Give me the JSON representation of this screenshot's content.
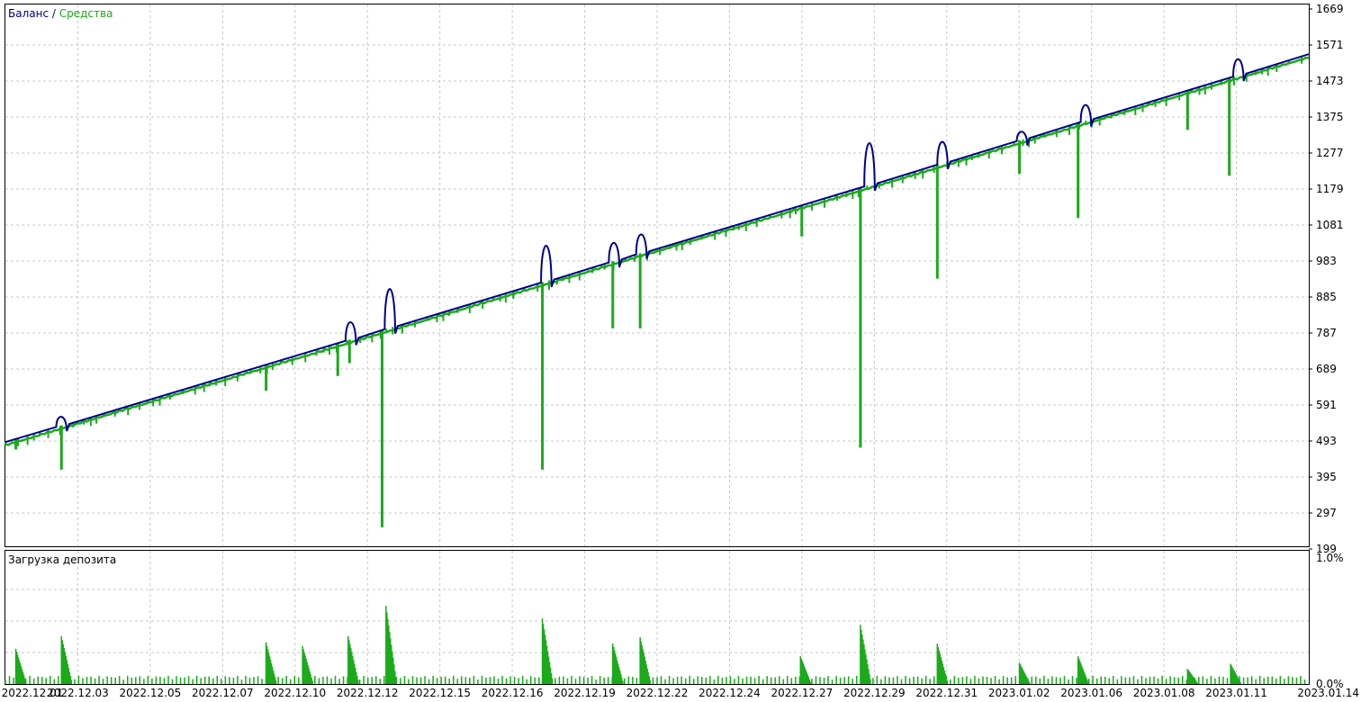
{
  "legend": {
    "balance_label": "Баланс",
    "separator": " / ",
    "equity_label": "Средства",
    "balance_color": "#00008b",
    "equity_color": "#1aaa1a"
  },
  "deposit_label": "Загрузка депозита",
  "chart_data": [
    {
      "type": "line",
      "title": "",
      "series": [
        {
          "name": "Баланс",
          "color": "#00008b"
        },
        {
          "name": "Средства",
          "color": "#1aaa1a"
        }
      ],
      "x_ticks": [
        "2022.12.01",
        "2022.12.03",
        "2022.12.05",
        "2022.12.07",
        "2022.12.10",
        "2022.12.12",
        "2022.12.15",
        "2022.12.16",
        "2022.12.19",
        "2022.12.22",
        "2022.12.24",
        "2022.12.27",
        "2022.12.29",
        "2022.12.31",
        "2023.01.02",
        "2023.01.06",
        "2023.01.08",
        "2023.01.11",
        "2023.01.14"
      ],
      "y_ticks": [
        "1669",
        "1571",
        "1473",
        "1375",
        "1277",
        "1179",
        "1081",
        "983",
        "885",
        "787",
        "689",
        "591",
        "493",
        "395",
        "297",
        "199"
      ],
      "ylim": [
        199,
        1669
      ],
      "trend": [
        {
          "x": 0,
          "y": 490
        },
        {
          "x": 1,
          "y": 1546
        }
      ],
      "balance_bumps": [
        {
          "x": 0.043,
          "peak": 560
        },
        {
          "x": 0.265,
          "peak": 825
        },
        {
          "x": 0.295,
          "peak": 935
        },
        {
          "x": 0.415,
          "peak": 1050
        },
        {
          "x": 0.467,
          "peak": 1042
        },
        {
          "x": 0.488,
          "peak": 1065
        },
        {
          "x": 0.663,
          "peak": 1335
        },
        {
          "x": 0.719,
          "peak": 1320
        },
        {
          "x": 0.78,
          "peak": 1335
        },
        {
          "x": 0.829,
          "peak": 1415
        },
        {
          "x": 0.946,
          "peak": 1540
        }
      ],
      "equity_dips": [
        {
          "x": 0.008,
          "low": 470
        },
        {
          "x": 0.043,
          "low": 415
        },
        {
          "x": 0.2,
          "low": 630
        },
        {
          "x": 0.255,
          "low": 670
        },
        {
          "x": 0.264,
          "low": 705
        },
        {
          "x": 0.289,
          "low": 258
        },
        {
          "x": 0.412,
          "low": 415
        },
        {
          "x": 0.466,
          "low": 800
        },
        {
          "x": 0.487,
          "low": 800
        },
        {
          "x": 0.611,
          "low": 1050
        },
        {
          "x": 0.656,
          "low": 475
        },
        {
          "x": 0.715,
          "low": 935
        },
        {
          "x": 0.778,
          "low": 1220
        },
        {
          "x": 0.823,
          "low": 1100
        },
        {
          "x": 0.907,
          "low": 1340
        },
        {
          "x": 0.939,
          "low": 1215
        }
      ]
    },
    {
      "type": "bar",
      "title": "Загрузка депозита",
      "y_ticks": [
        "1.0%",
        "0.0%"
      ],
      "ylim": [
        0,
        1.0
      ],
      "spikes": [
        {
          "x": 0.008,
          "value": 0.28
        },
        {
          "x": 0.043,
          "value": 0.38
        },
        {
          "x": 0.2,
          "value": 0.33
        },
        {
          "x": 0.228,
          "value": 0.3
        },
        {
          "x": 0.263,
          "value": 0.38
        },
        {
          "x": 0.292,
          "value": 0.62
        },
        {
          "x": 0.412,
          "value": 0.52
        },
        {
          "x": 0.466,
          "value": 0.32
        },
        {
          "x": 0.487,
          "value": 0.37
        },
        {
          "x": 0.61,
          "value": 0.22
        },
        {
          "x": 0.656,
          "value": 0.47
        },
        {
          "x": 0.715,
          "value": 0.32
        },
        {
          "x": 0.778,
          "value": 0.17
        },
        {
          "x": 0.823,
          "value": 0.22
        },
        {
          "x": 0.907,
          "value": 0.12
        },
        {
          "x": 0.94,
          "value": 0.16
        }
      ]
    }
  ]
}
